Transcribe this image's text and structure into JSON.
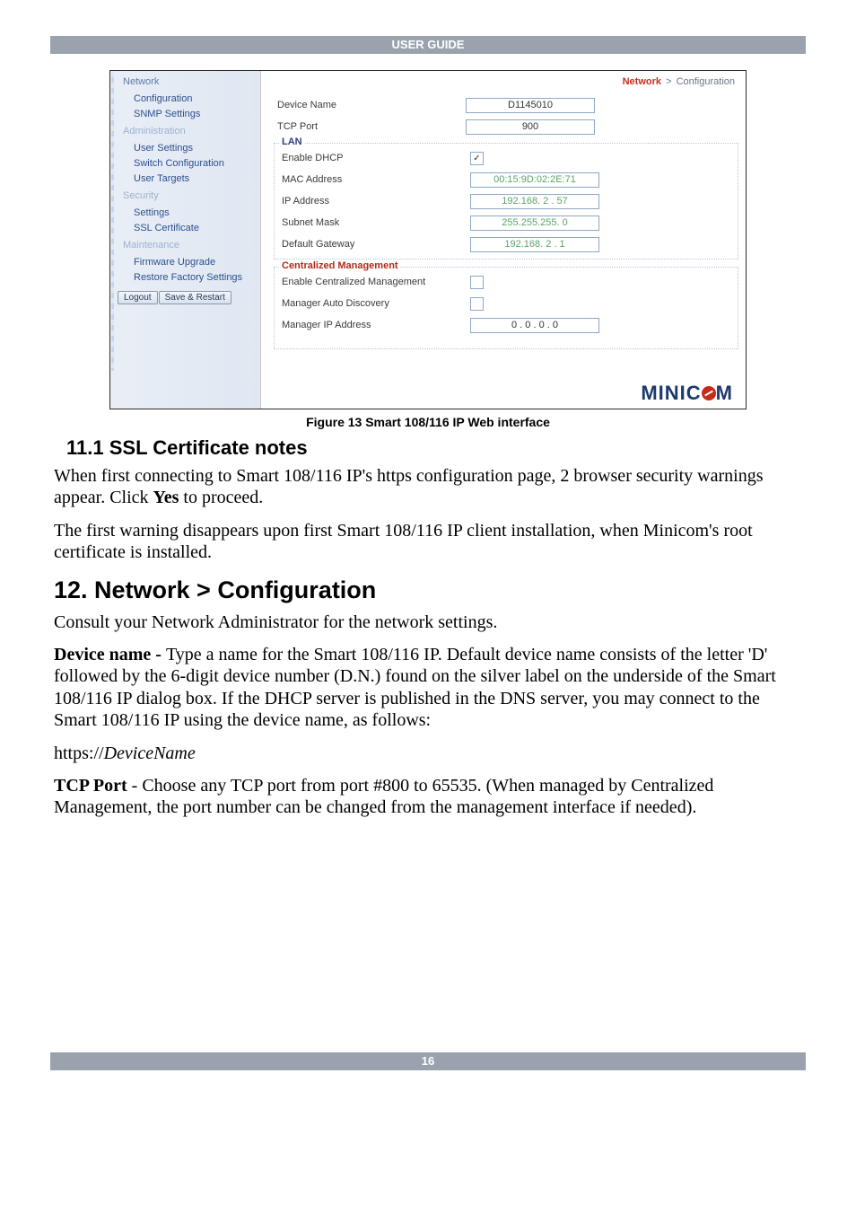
{
  "header": {
    "title": "USER GUIDE"
  },
  "footer": {
    "page": "16"
  },
  "screenshot": {
    "nav": {
      "sections": [
        {
          "label": "Network",
          "dim": false,
          "subs": [
            {
              "label": "Configuration"
            },
            {
              "label": "SNMP Settings"
            }
          ]
        },
        {
          "label": "Administration",
          "dim": true,
          "subs": [
            {
              "label": "User Settings"
            },
            {
              "label": "Switch Configuration"
            },
            {
              "label": "User Targets"
            }
          ]
        },
        {
          "label": "Security",
          "dim": true,
          "subs": [
            {
              "label": "Settings"
            },
            {
              "label": "SSL Certificate"
            }
          ]
        },
        {
          "label": "Maintenance",
          "dim": true,
          "subs": [
            {
              "label": "Firmware Upgrade"
            },
            {
              "label": "Restore Factory Settings"
            }
          ]
        }
      ],
      "buttons": {
        "logout": "Logout",
        "save": "Save & Restart"
      }
    },
    "crumb": {
      "root": "Network",
      "sep": ">",
      "leaf": "Configuration"
    },
    "top_rows": [
      {
        "label": "Device Name",
        "value": "D1145010",
        "ro": false
      },
      {
        "label": "TCP Port",
        "value": "900",
        "ro": false
      }
    ],
    "lan": {
      "title": "LAN",
      "rows": [
        {
          "label": "Enable DHCP",
          "kind": "check",
          "checked": true
        },
        {
          "label": "MAC Address",
          "kind": "ro",
          "value": "00:15:9D:02:2E:71"
        },
        {
          "label": "IP Address",
          "kind": "ro",
          "value": "192.168. 2 . 57"
        },
        {
          "label": "Subnet Mask",
          "kind": "ro",
          "value": "255.255.255. 0"
        },
        {
          "label": "Default Gateway",
          "kind": "ro",
          "value": "192.168. 2 . 1"
        }
      ]
    },
    "cm": {
      "title": "Centralized Management",
      "rows": [
        {
          "label": "Enable Centralized Management",
          "kind": "check",
          "checked": false
        },
        {
          "label": "Manager Auto Discovery",
          "kind": "check",
          "checked": false
        },
        {
          "label": "Manager IP Address",
          "kind": "field",
          "value": "0 . 0 . 0 . 0"
        }
      ]
    },
    "logo": {
      "pre": "MINIC",
      "post": "M"
    }
  },
  "caption": "Figure 13 Smart 108/116 IP Web interface",
  "doc": {
    "s111_title": "11.1 SSL Certificate notes",
    "p1a": "When first connecting to Smart 108/116 IP's https configuration page, 2 browser security warnings appear. Click ",
    "p1b_bold": "Yes",
    "p1c": " to proceed.",
    "p2": "The first warning disappears upon first Smart 108/116 IP client installation, when Minicom's root certificate is installed.",
    "s12_title": "12. Network > Configuration",
    "p3": "Consult your Network Administrator for the network settings.",
    "p4_lead_bold": "Device name - ",
    "p4_rest": "Type a name for the Smart 108/116 IP. Default device name consists of the letter 'D' followed by the 6-digit device number (D.N.) found on the silver label on the underside of the Smart 108/116 IP dialog box. If the DHCP server is published in the DNS server, you may connect to the Smart 108/116 IP using the device name, as follows:",
    "p5a": "https://",
    "p5b_italic": "DeviceName",
    "p6_lead_bold": "TCP Port",
    "p6_rest": " - Choose any TCP port from port #800 to 65535. (When managed by Centralized Management, the port number can be changed from the management interface if needed)."
  }
}
